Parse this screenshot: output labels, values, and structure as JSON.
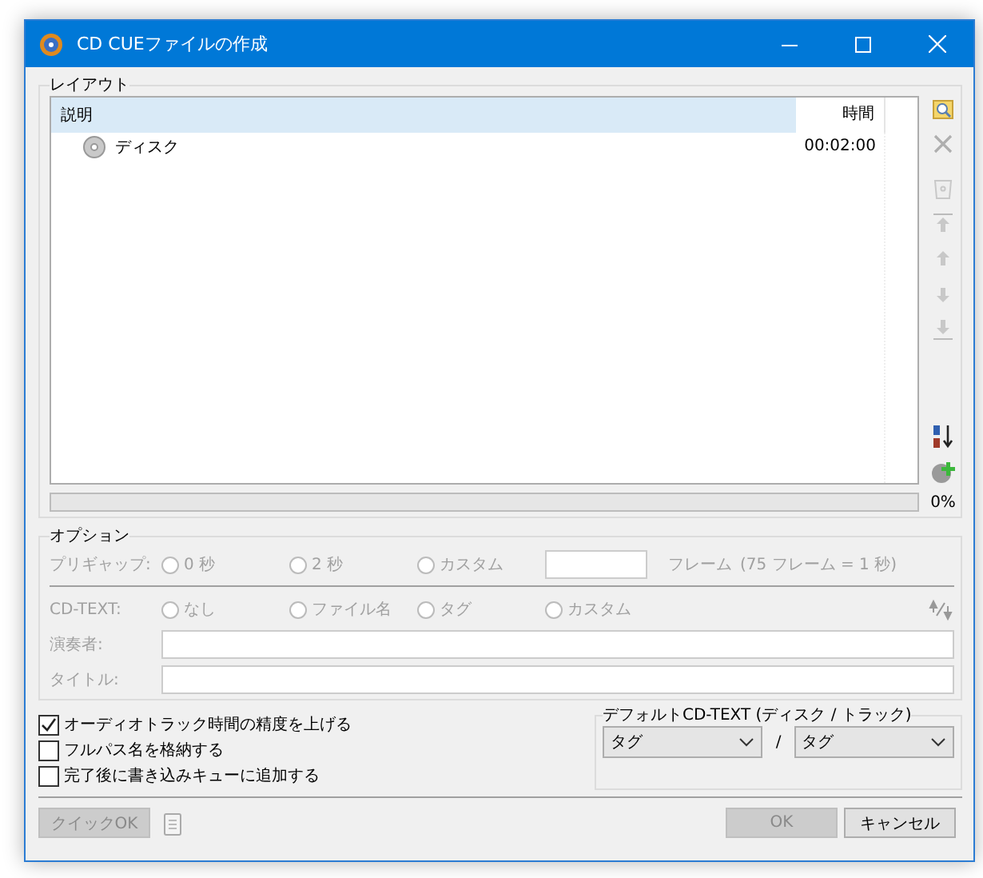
{
  "window": {
    "title": "CD CUEファイルの作成"
  },
  "layout": {
    "label": "レイアウト",
    "columns": [
      "説明",
      "時間"
    ],
    "rows": [
      {
        "name": "ディスク",
        "time": "00:02:00"
      }
    ],
    "progress": {
      "level": 0,
      "text": "0%"
    },
    "tools": [
      {
        "kind": "browse",
        "disabled": false
      },
      {
        "kind": "delete",
        "disabled": true
      },
      {
        "kind": "clear",
        "disabled": true
      },
      {
        "kind": "top",
        "disabled": true
      },
      {
        "kind": "up",
        "disabled": true
      },
      {
        "kind": "down",
        "disabled": true
      },
      {
        "kind": "bottom",
        "disabled": true
      },
      {
        "kind": "sort",
        "disabled": false
      },
      {
        "kind": "add",
        "disabled": false
      }
    ]
  },
  "options": {
    "label": "オプション",
    "disabled": true,
    "pregap": {
      "label": "プリギャップ:",
      "radios": [
        {
          "label": "0 秒",
          "selected": false
        },
        {
          "label": "2 秒",
          "selected": false
        },
        {
          "label": "カスタム",
          "selected": false
        }
      ],
      "unit": "フレーム",
      "note": "(75 フレーム = 1 秒)"
    },
    "cdtext": {
      "label": "CD-TEXT:",
      "radios": [
        {
          "label": "なし",
          "selected": false
        },
        {
          "label": "ファイル名",
          "selected": false
        },
        {
          "label": "タグ",
          "selected": false
        },
        {
          "label": "カスタム",
          "selected": false
        }
      ]
    },
    "fields": [
      {
        "label": "演奏者:"
      },
      {
        "label": "タイトル:"
      }
    ]
  },
  "checkboxes": [
    {
      "label": "オーディオトラック時間の精度を上げる",
      "checked": true
    },
    {
      "label": "フルパス名を格納する",
      "checked": false
    },
    {
      "label": "完了後に書き込みキューに追加する",
      "checked": false
    }
  ],
  "default_cdtext": {
    "label": "デフォルトCD-TEXT (ディスク / トラック)",
    "disc": "タグ",
    "separator": "/",
    "track": "タグ"
  },
  "buttons": {
    "quick_ok": {
      "label": "クイックOK",
      "disabled": true
    },
    "ok": {
      "label": "OK",
      "disabled": true
    },
    "cancel": {
      "label": "キャンセル",
      "disabled": false
    }
  }
}
